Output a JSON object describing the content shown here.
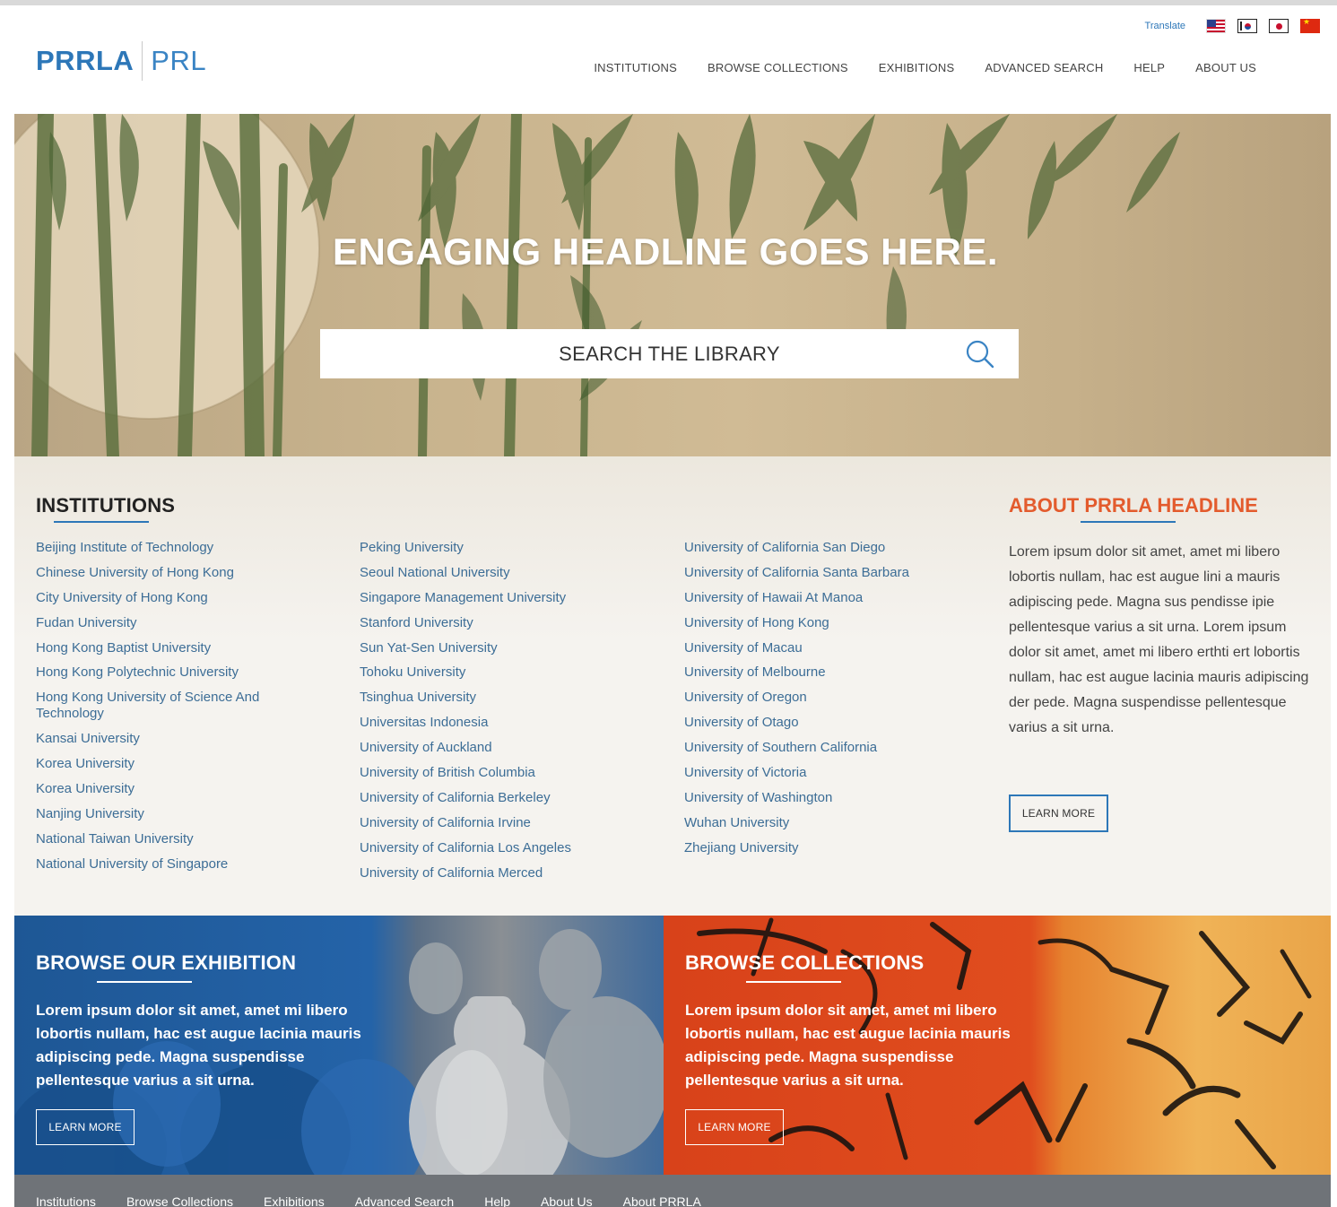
{
  "logo": {
    "primary": "PRRLA",
    "secondary": "PRL"
  },
  "utility": {
    "translate_label": "Translate",
    "flags": [
      "us-flag-icon",
      "korea-flag-icon",
      "japan-flag-icon",
      "china-flag-icon"
    ]
  },
  "nav": {
    "items": [
      "INSTITUTIONS",
      "BROWSE COLLECTIONS",
      "EXHIBITIONS",
      "ADVANCED SEARCH",
      "HELP",
      "ABOUT US"
    ]
  },
  "hero": {
    "headline": "ENGAGING HEADLINE GOES HERE.",
    "search_placeholder": "SEARCH THE LIBRARY"
  },
  "institutions": {
    "title": "INSTITUTIONS",
    "columns": [
      [
        "Beijing Institute of Technology",
        "Chinese University of Hong Kong",
        "City University of Hong Kong",
        "Fudan University",
        "Hong Kong Baptist University",
        "Hong Kong Polytechnic University",
        "Hong Kong University of Science And Technology",
        "Kansai University",
        "Korea University",
        "Korea University",
        "Nanjing University",
        "National Taiwan University",
        "National University of Singapore"
      ],
      [
        "Peking University",
        "Seoul National University",
        "Singapore Management University",
        "Stanford University",
        "Sun Yat-Sen University",
        "Tohoku University",
        "Tsinghua University",
        "Universitas Indonesia",
        "University of Auckland",
        "University of British Columbia",
        "University of California Berkeley",
        "University of California Irvine",
        "University of California Los Angeles",
        "University of California Merced"
      ],
      [
        "University of California San Diego",
        "University of California Santa Barbara",
        "University of Hawaii At Manoa",
        "University of Hong Kong",
        "University of Macau",
        "University of Melbourne",
        "University of Oregon",
        "University of Otago",
        "University of Southern California",
        "University of Victoria",
        "University of Washington",
        "Wuhan University",
        "Zhejiang University"
      ]
    ]
  },
  "about": {
    "title": "ABOUT PRRLA HEADLINE",
    "text": "Lorem ipsum dolor sit amet, amet mi libero lobortis nullam, hac est augue lini a mauris adipiscing pede. Magna sus pendisse ipie pellentesque varius a sit urna. Lorem ipsum dolor sit amet, amet mi libero erthti ert  lobortis nullam, hac est augue lacinia mauris adipiscing der pede. Magna suspendisse pellentesque varius a sit urna.",
    "button": "LEARN MORE"
  },
  "exhibition": {
    "title": "BROWSE OUR EXHIBITION",
    "text": "Lorem ipsum dolor sit amet, amet mi libero lobortis nullam, hac est augue lacinia mauris adipiscing pede. Magna suspendisse pellentesque varius a sit urna.",
    "button": "LEARN MORE"
  },
  "collections": {
    "title": "BROWSE COLLECTIONS",
    "text": "Lorem ipsum dolor sit amet, amet mi libero lobortis nullam, hac est augue lacinia mauris adipiscing pede. Magna suspendisse pellentesque varius a sit urna.",
    "button": "LEARN MORE"
  },
  "footer": {
    "links": [
      "Institutions",
      "Browse Collections",
      "Exhibitions",
      "Advanced Search",
      "Help",
      "About Us",
      "About PRRLA"
    ]
  },
  "colors": {
    "brand_blue": "#2d77b8",
    "accent_orange": "#e35b2d",
    "footer_gray": "#6f7378"
  }
}
